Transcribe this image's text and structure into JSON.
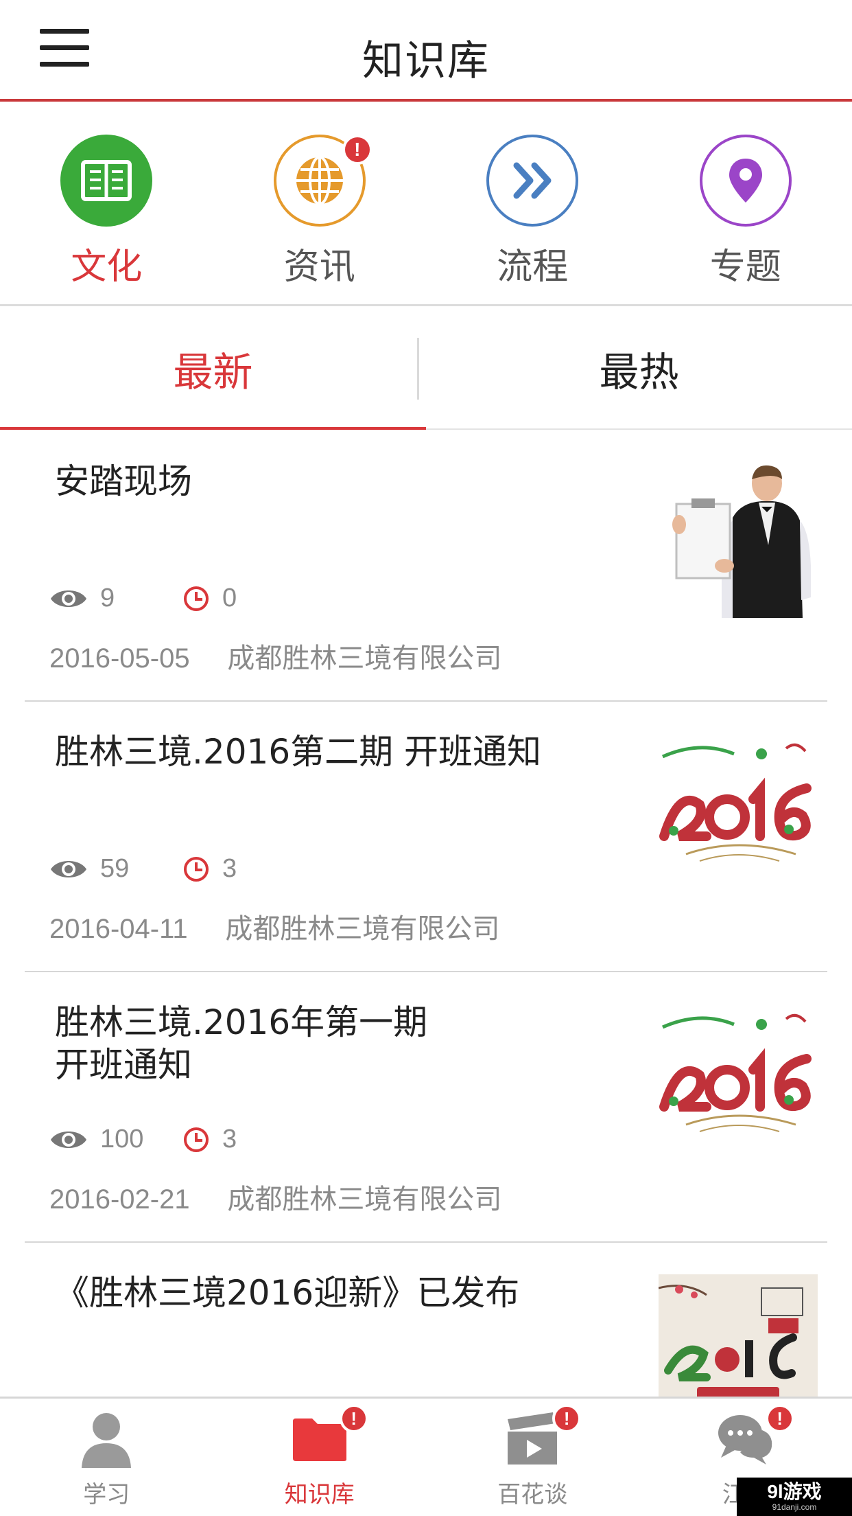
{
  "header": {
    "title": "知识库"
  },
  "categories": [
    {
      "label": "文化",
      "icon": "book-icon",
      "color": "#3aaa3a",
      "active": true,
      "badge": ""
    },
    {
      "label": "资讯",
      "icon": "globe-icon",
      "color": "#e59a2c",
      "active": false,
      "badge": "!"
    },
    {
      "label": "流程",
      "icon": "double-chevron-right-icon",
      "color": "#4a7fc1",
      "active": false,
      "badge": ""
    },
    {
      "label": "专题",
      "icon": "location-pin-icon",
      "color": "#9b45c8",
      "active": false,
      "badge": ""
    }
  ],
  "tabs": [
    {
      "label": "最新",
      "active": true
    },
    {
      "label": "最热",
      "active": false
    }
  ],
  "items": [
    {
      "title": "安踏现场",
      "views": "9",
      "comments": "0",
      "date": "2016-05-05",
      "company": "成都胜林三境有限公司",
      "thumb": "waiter-holding-board-image"
    },
    {
      "title": "胜林三境.2016第二期 开班通知",
      "views": "59",
      "comments": "3",
      "date": "2016-04-11",
      "company": "成都胜林三境有限公司",
      "thumb": "2016-class-start-image"
    },
    {
      "title": "胜林三境.2016年第一期\n开班通知",
      "views": "100",
      "comments": "3",
      "date": "2016-02-21",
      "company": "成都胜林三境有限公司",
      "thumb": "2016-class-start-image"
    },
    {
      "title": "《胜林三境2016迎新》已发布",
      "views": "",
      "comments": "",
      "date": "",
      "company": "",
      "thumb": "2016-new-year-poster-image"
    }
  ],
  "bottom_nav": [
    {
      "label": "学习",
      "icon": "person-icon",
      "active": false,
      "badge": ""
    },
    {
      "label": "知识库",
      "icon": "folder-icon",
      "active": true,
      "badge": "!"
    },
    {
      "label": "百花谈",
      "icon": "video-clapper-icon",
      "active": false,
      "badge": "!"
    },
    {
      "label": "江湖",
      "icon": "chat-bubbles-icon",
      "active": false,
      "badge": "!"
    }
  ],
  "watermark": {
    "main": "9l游戏",
    "sub": "91danji.com"
  },
  "colors": {
    "accent": "#d9373a",
    "divider": "#d6d6d6",
    "muted_text": "#8a8a8a"
  }
}
